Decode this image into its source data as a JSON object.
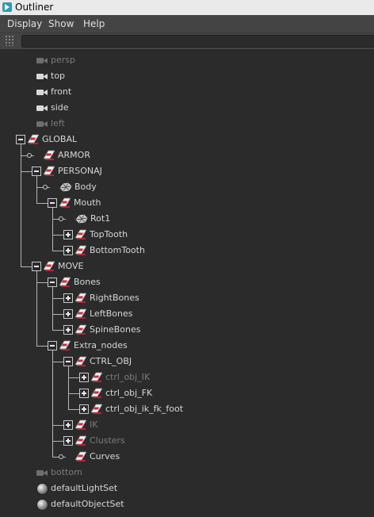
{
  "window": {
    "title": "Outliner"
  },
  "menu": [
    "Display",
    "Show",
    "Help"
  ],
  "filter": {
    "value": "",
    "placeholder": ""
  },
  "rows": [
    {
      "label": "persp",
      "icon": "camera-icon",
      "dim": true,
      "depth": 0
    },
    {
      "label": "top",
      "icon": "camera-icon",
      "dim": false,
      "depth": 0
    },
    {
      "label": "front",
      "icon": "camera-icon",
      "dim": false,
      "depth": 0
    },
    {
      "label": "side",
      "icon": "camera-icon",
      "dim": false,
      "depth": 0
    },
    {
      "label": "left",
      "icon": "camera-icon",
      "dim": true,
      "depth": 0
    },
    {
      "label": "GLOBAL",
      "icon": "group-icon",
      "dim": false,
      "depth": 0,
      "expander": "expanded"
    },
    {
      "label": "ARMOR",
      "icon": "group-icon",
      "dim": false,
      "depth": 1,
      "expander": "none"
    },
    {
      "label": "PERSONAJ",
      "icon": "group-icon",
      "dim": false,
      "depth": 1,
      "expander": "expanded"
    },
    {
      "label": "Body",
      "icon": "mesh-icon",
      "dim": false,
      "depth": 2,
      "expander": "none"
    },
    {
      "label": "Mouth",
      "icon": "group-icon",
      "dim": false,
      "depth": 2,
      "expander": "expanded"
    },
    {
      "label": "Rot1",
      "icon": "mesh-icon",
      "dim": false,
      "depth": 3,
      "expander": "none"
    },
    {
      "label": "TopTooth",
      "icon": "group-icon",
      "dim": false,
      "depth": 3,
      "expander": "collapsed"
    },
    {
      "label": "BottomTooth",
      "icon": "group-icon",
      "dim": false,
      "depth": 3,
      "expander": "collapsed"
    },
    {
      "label": "MOVE",
      "icon": "group-icon",
      "dim": false,
      "depth": 1,
      "expander": "expanded"
    },
    {
      "label": "Bones",
      "icon": "group-icon",
      "dim": false,
      "depth": 2,
      "expander": "expanded"
    },
    {
      "label": "RightBones",
      "icon": "group-icon",
      "dim": false,
      "depth": 3,
      "expander": "collapsed"
    },
    {
      "label": "LeftBones",
      "icon": "group-icon",
      "dim": false,
      "depth": 3,
      "expander": "collapsed"
    },
    {
      "label": "SpineBones",
      "icon": "group-icon",
      "dim": false,
      "depth": 3,
      "expander": "collapsed"
    },
    {
      "label": "Extra_nodes",
      "icon": "group-icon",
      "dim": false,
      "depth": 2,
      "expander": "expanded"
    },
    {
      "label": "CTRL_OBJ",
      "icon": "group-icon",
      "dim": false,
      "depth": 3,
      "expander": "expanded"
    },
    {
      "label": "ctrl_obj_IK",
      "icon": "group-icon",
      "dim": true,
      "depth": 4,
      "expander": "collapsed"
    },
    {
      "label": "ctrl_obj_FK",
      "icon": "group-icon",
      "dim": false,
      "depth": 4,
      "expander": "collapsed"
    },
    {
      "label": "ctrl_obj_ik_fk_foot",
      "icon": "group-icon",
      "dim": false,
      "depth": 4,
      "expander": "collapsed"
    },
    {
      "label": "IK",
      "icon": "group-icon",
      "dim": true,
      "depth": 3,
      "expander": "collapsed"
    },
    {
      "label": "Clusters",
      "icon": "group-icon",
      "dim": true,
      "depth": 3,
      "expander": "collapsed"
    },
    {
      "label": "Curves",
      "icon": "group-icon",
      "dim": false,
      "depth": 3,
      "expander": "none"
    },
    {
      "label": "bottom",
      "icon": "camera-icon",
      "dim": true,
      "depth": 0
    },
    {
      "label": "defaultLightSet",
      "icon": "set-icon",
      "dim": false,
      "depth": 0
    },
    {
      "label": "defaultObjectSet",
      "icon": "set-icon",
      "dim": false,
      "depth": 0
    }
  ]
}
